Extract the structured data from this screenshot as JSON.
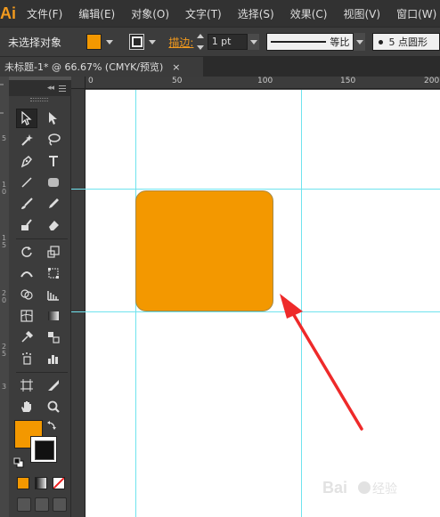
{
  "app": {
    "logo": "Ai"
  },
  "menu": [
    "文件(F)",
    "编辑(E)",
    "对象(O)",
    "文字(T)",
    "选择(S)",
    "效果(C)",
    "视图(V)",
    "窗口(W)"
  ],
  "control": {
    "selection_label": "未选择对象",
    "fill_color": "#f39800",
    "stroke_label": "描边:",
    "stroke_weight": "1 pt",
    "profile_label": "等比",
    "brush_label": "5 点圆形"
  },
  "document": {
    "tab_title": "未标题-1* @ 66.67% (CMYK/预览)",
    "close_glyph": "×"
  },
  "ruler": {
    "labels": [
      "0",
      "50",
      "100",
      "150",
      "200"
    ]
  },
  "left_strip": {
    "digits": [
      "5",
      "1",
      "0",
      "1",
      "5",
      "2",
      "0",
      "2",
      "5",
      "3"
    ]
  },
  "toolbar": {
    "collapse_glyph": "◂◂",
    "tools": [
      "selection-tool",
      "direct-selection-tool",
      "magic-wand-tool",
      "lasso-tool",
      "pen-tool",
      "type-tool",
      "line-segment-tool",
      "rounded-rectangle-tool",
      "paintbrush-tool",
      "pencil-tool",
      "blob-brush-tool",
      "eraser-tool",
      "rotate-tool",
      "scale-tool",
      "width-tool",
      "free-transform-tool",
      "shape-builder-tool",
      "perspective-grid-tool",
      "mesh-tool",
      "gradient-tool",
      "eyedropper-tool",
      "blend-tool",
      "symbol-sprayer-tool",
      "column-graph-tool",
      "artboard-tool",
      "slice-tool",
      "hand-tool",
      "zoom-tool"
    ],
    "fill_color": "#f39800",
    "stroke_color": "#111111"
  },
  "canvas": {
    "shape_fill": "#f39800",
    "guide_color": "#6fe3ee",
    "arrow_color": "#ee2a2a"
  }
}
